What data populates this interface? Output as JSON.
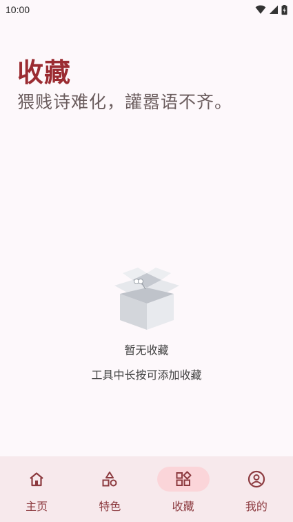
{
  "status_bar": {
    "time": "10:00",
    "icons": [
      "wifi-icon",
      "cellular-signal-icon",
      "battery-icon"
    ]
  },
  "header": {
    "title": "收藏",
    "subtitle": "猥贱诗难化，讙嚣语不齐。"
  },
  "empty_state": {
    "icon": "empty-box-icon",
    "title": "暂无收藏",
    "hint": "工具中长按可添加收藏"
  },
  "bottom_nav": {
    "items": [
      {
        "label": "主页",
        "icon": "home-icon",
        "active": false
      },
      {
        "label": "特色",
        "icon": "shapes-icon",
        "active": false
      },
      {
        "label": "收藏",
        "icon": "grid-diamond-icon",
        "active": true
      },
      {
        "label": "我的",
        "icon": "profile-icon",
        "active": false
      }
    ]
  },
  "colors": {
    "accent": "#9b2c32",
    "nav_background": "#f7e9ec",
    "active_pill": "#fbd5d9",
    "background": "#fdf8fb"
  }
}
